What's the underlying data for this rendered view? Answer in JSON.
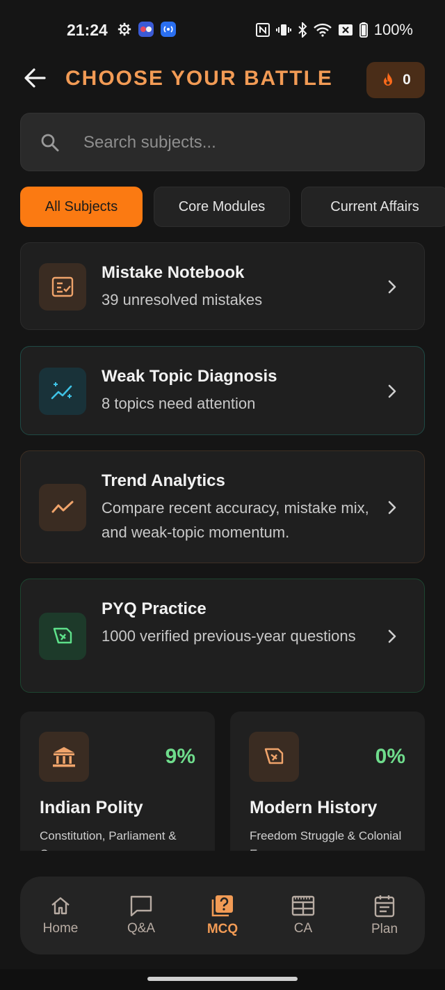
{
  "status_bar": {
    "time": "21:24",
    "battery": "100%",
    "left_icons": [
      "gear-icon",
      "app-notification-icon",
      "broadcast-icon"
    ],
    "right_icons": [
      "nfc-icon",
      "vibrate-icon",
      "bluetooth-icon",
      "wifi-icon",
      "no-sim-icon",
      "battery-icon"
    ]
  },
  "header": {
    "title": "CHOOSE YOUR BATTLE",
    "streak_count": "0",
    "accent_color": "#f29b55"
  },
  "search": {
    "placeholder": "Search subjects..."
  },
  "filters": [
    {
      "label": "All Subjects",
      "active": true
    },
    {
      "label": "Core Modules",
      "active": false
    },
    {
      "label": "Current Affairs",
      "active": false
    }
  ],
  "tools": [
    {
      "title": "Mistake Notebook",
      "subtitle": "39 unresolved mistakes",
      "icon": "notebook-icon"
    },
    {
      "title": "Weak Topic Diagnosis",
      "subtitle": "8 topics need attention",
      "icon": "sparkle-trend-icon"
    },
    {
      "title": "Trend Analytics",
      "subtitle": "Compare recent accuracy, mistake mix, and weak-topic momentum.",
      "icon": "trend-line-icon"
    },
    {
      "title": "PYQ Practice",
      "subtitle": "1000 verified previous-year questions",
      "icon": "scroll-icon"
    }
  ],
  "subjects": [
    {
      "name": "Indian Polity",
      "percent": "9%",
      "description": "Constitution, Parliament & Governance",
      "icon": "government-building-icon"
    },
    {
      "name": "Modern History",
      "percent": "0%",
      "description": "Freedom Struggle & Colonial Era",
      "icon": "scroll-icon"
    }
  ],
  "nav": [
    {
      "label": "Home",
      "icon": "home-icon",
      "active": false
    },
    {
      "label": "Q&A",
      "icon": "chat-icon",
      "active": false
    },
    {
      "label": "MCQ",
      "icon": "question-icon",
      "active": true
    },
    {
      "label": "CA",
      "icon": "newspaper-icon",
      "active": false
    },
    {
      "label": "Plan",
      "icon": "calendar-icon",
      "active": false
    }
  ]
}
